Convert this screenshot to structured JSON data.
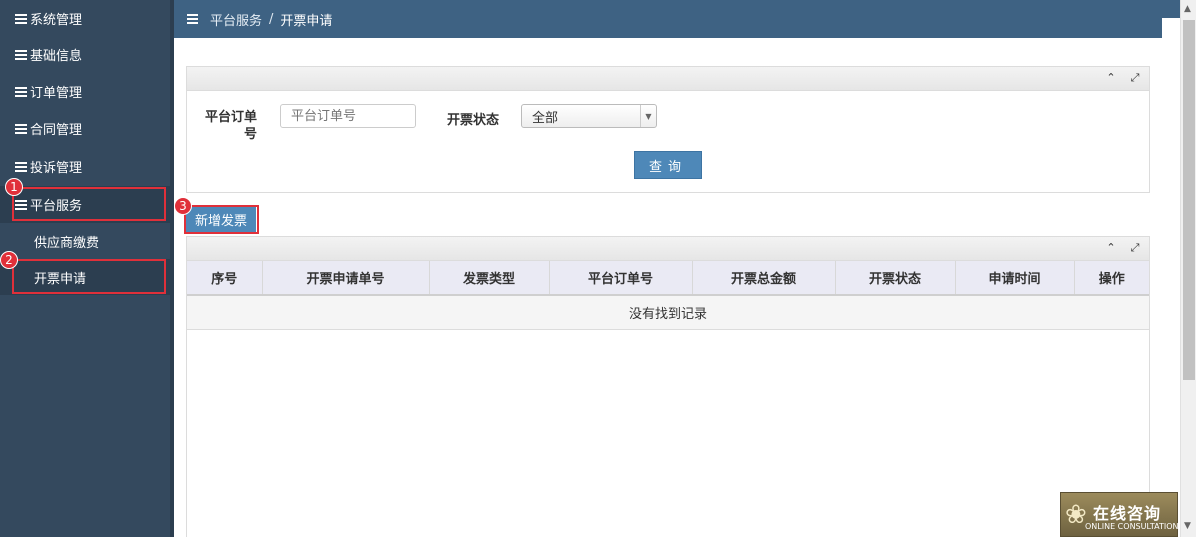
{
  "sidebar": {
    "items": [
      {
        "label": "系统管理"
      },
      {
        "label": "基础信息"
      },
      {
        "label": "订单管理"
      },
      {
        "label": "合同管理"
      },
      {
        "label": "投诉管理"
      },
      {
        "label": "平台服务"
      }
    ],
    "subitems": [
      {
        "label": "供应商缴费"
      },
      {
        "label": "开票申请"
      }
    ]
  },
  "badges": [
    "1",
    "2",
    "3"
  ],
  "breadcrumb": {
    "parent": "平台服务",
    "separator": "/",
    "current": "开票申请"
  },
  "search": {
    "order_label": "平台订单号",
    "order_placeholder": "平台订单号",
    "status_label": "开票状态",
    "status_value": "全部",
    "query_button": "查询"
  },
  "add_button": "新增发票",
  "table": {
    "headers": [
      "序号",
      "开票申请单号",
      "发票类型",
      "平台订单号",
      "开票总金额",
      "开票状态",
      "申请时间",
      "操作"
    ],
    "empty_text": "没有找到记录"
  },
  "consult": {
    "title": "在线咨询",
    "subtitle": "ONLINE CONSULTATION"
  },
  "colors": {
    "sidebar": "#34495e",
    "topbar": "#3e6283",
    "primary": "#4e88b8",
    "highlight": "#e0303a"
  }
}
